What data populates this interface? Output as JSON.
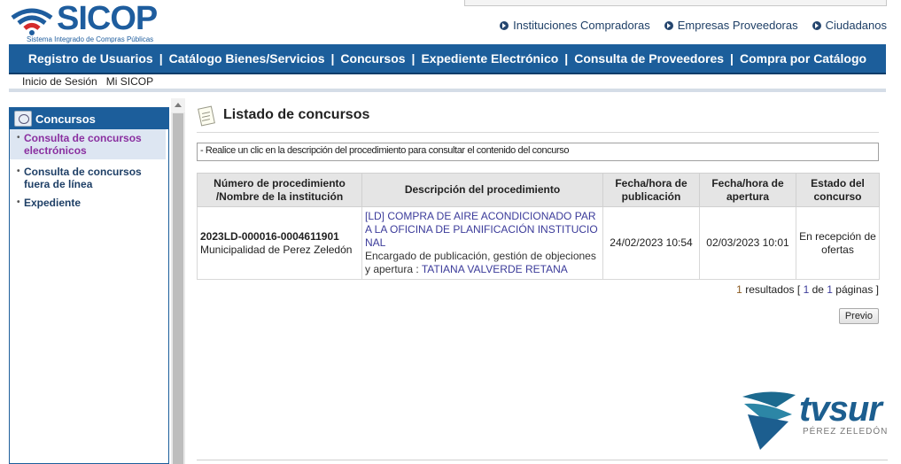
{
  "header": {
    "logo_text": "SICOP",
    "logo_sub": "Sistema Integrado de Compras Públicas",
    "top_links": [
      "Instituciones Compradoras",
      "Empresas Proveedoras",
      "Ciudadanos"
    ]
  },
  "main_nav": [
    "Registro de Usuarios",
    "Catálogo Bienes/Servicios",
    "Concursos",
    "Expediente Electrónico",
    "Consulta de Proveedores",
    "Compra por Catálogo"
  ],
  "main_nav_separator": "|",
  "sub_nav": [
    "Inicio de Sesión",
    "Mi SICOP"
  ],
  "sidebar": {
    "title": "Concursos",
    "items": [
      {
        "label": "Consulta de concursos electrónicos"
      },
      {
        "label": "Consulta de concursos fuera de línea"
      },
      {
        "label": "Expediente"
      }
    ],
    "bullet": "•"
  },
  "content": {
    "title": "Listado de concursos",
    "hint": "- Realice un clic en la descripción del procedimiento para consultar el contenido del concurso",
    "table": {
      "headers": [
        "Número de procedimiento /Nombre de la institución",
        "Descripción del procedimiento",
        "Fecha/hora de publicación",
        "Fecha/hora de apertura",
        "Estado del concurso"
      ],
      "rows": [
        {
          "numero": "2023LD-000016-0004611901",
          "institucion": "Municipalidad de Perez Zeledón",
          "descripcion": "[LD] COMPRA DE AIRE ACONDICIONADO PARA LA OFICINA DE PLANIFICACIÓN INSTITUCIONAL",
          "encargado_label": "Encargado de publicación, gestión de objeciones y apertura : ",
          "encargado": "TATIANA VALVERDE RETANA",
          "publicacion": "24/02/2023 10:54",
          "apertura": "02/03/2023 10:01",
          "estado": "En recepción de ofertas"
        }
      ]
    },
    "pager": {
      "count": "1",
      "results_label": " resultados [ ",
      "page": "1",
      "of_label": " de ",
      "total_pages": "1",
      "pages_label": " páginas ]"
    },
    "prev_button": "Previo"
  },
  "watermark": {
    "text": "tvsur",
    "sub": "PÉREZ ZELEDÓN"
  },
  "colors": {
    "nav_blue": "#1c5e9b",
    "link_purple": "#8a2fa0",
    "link_blue": "#3b3b9a"
  }
}
